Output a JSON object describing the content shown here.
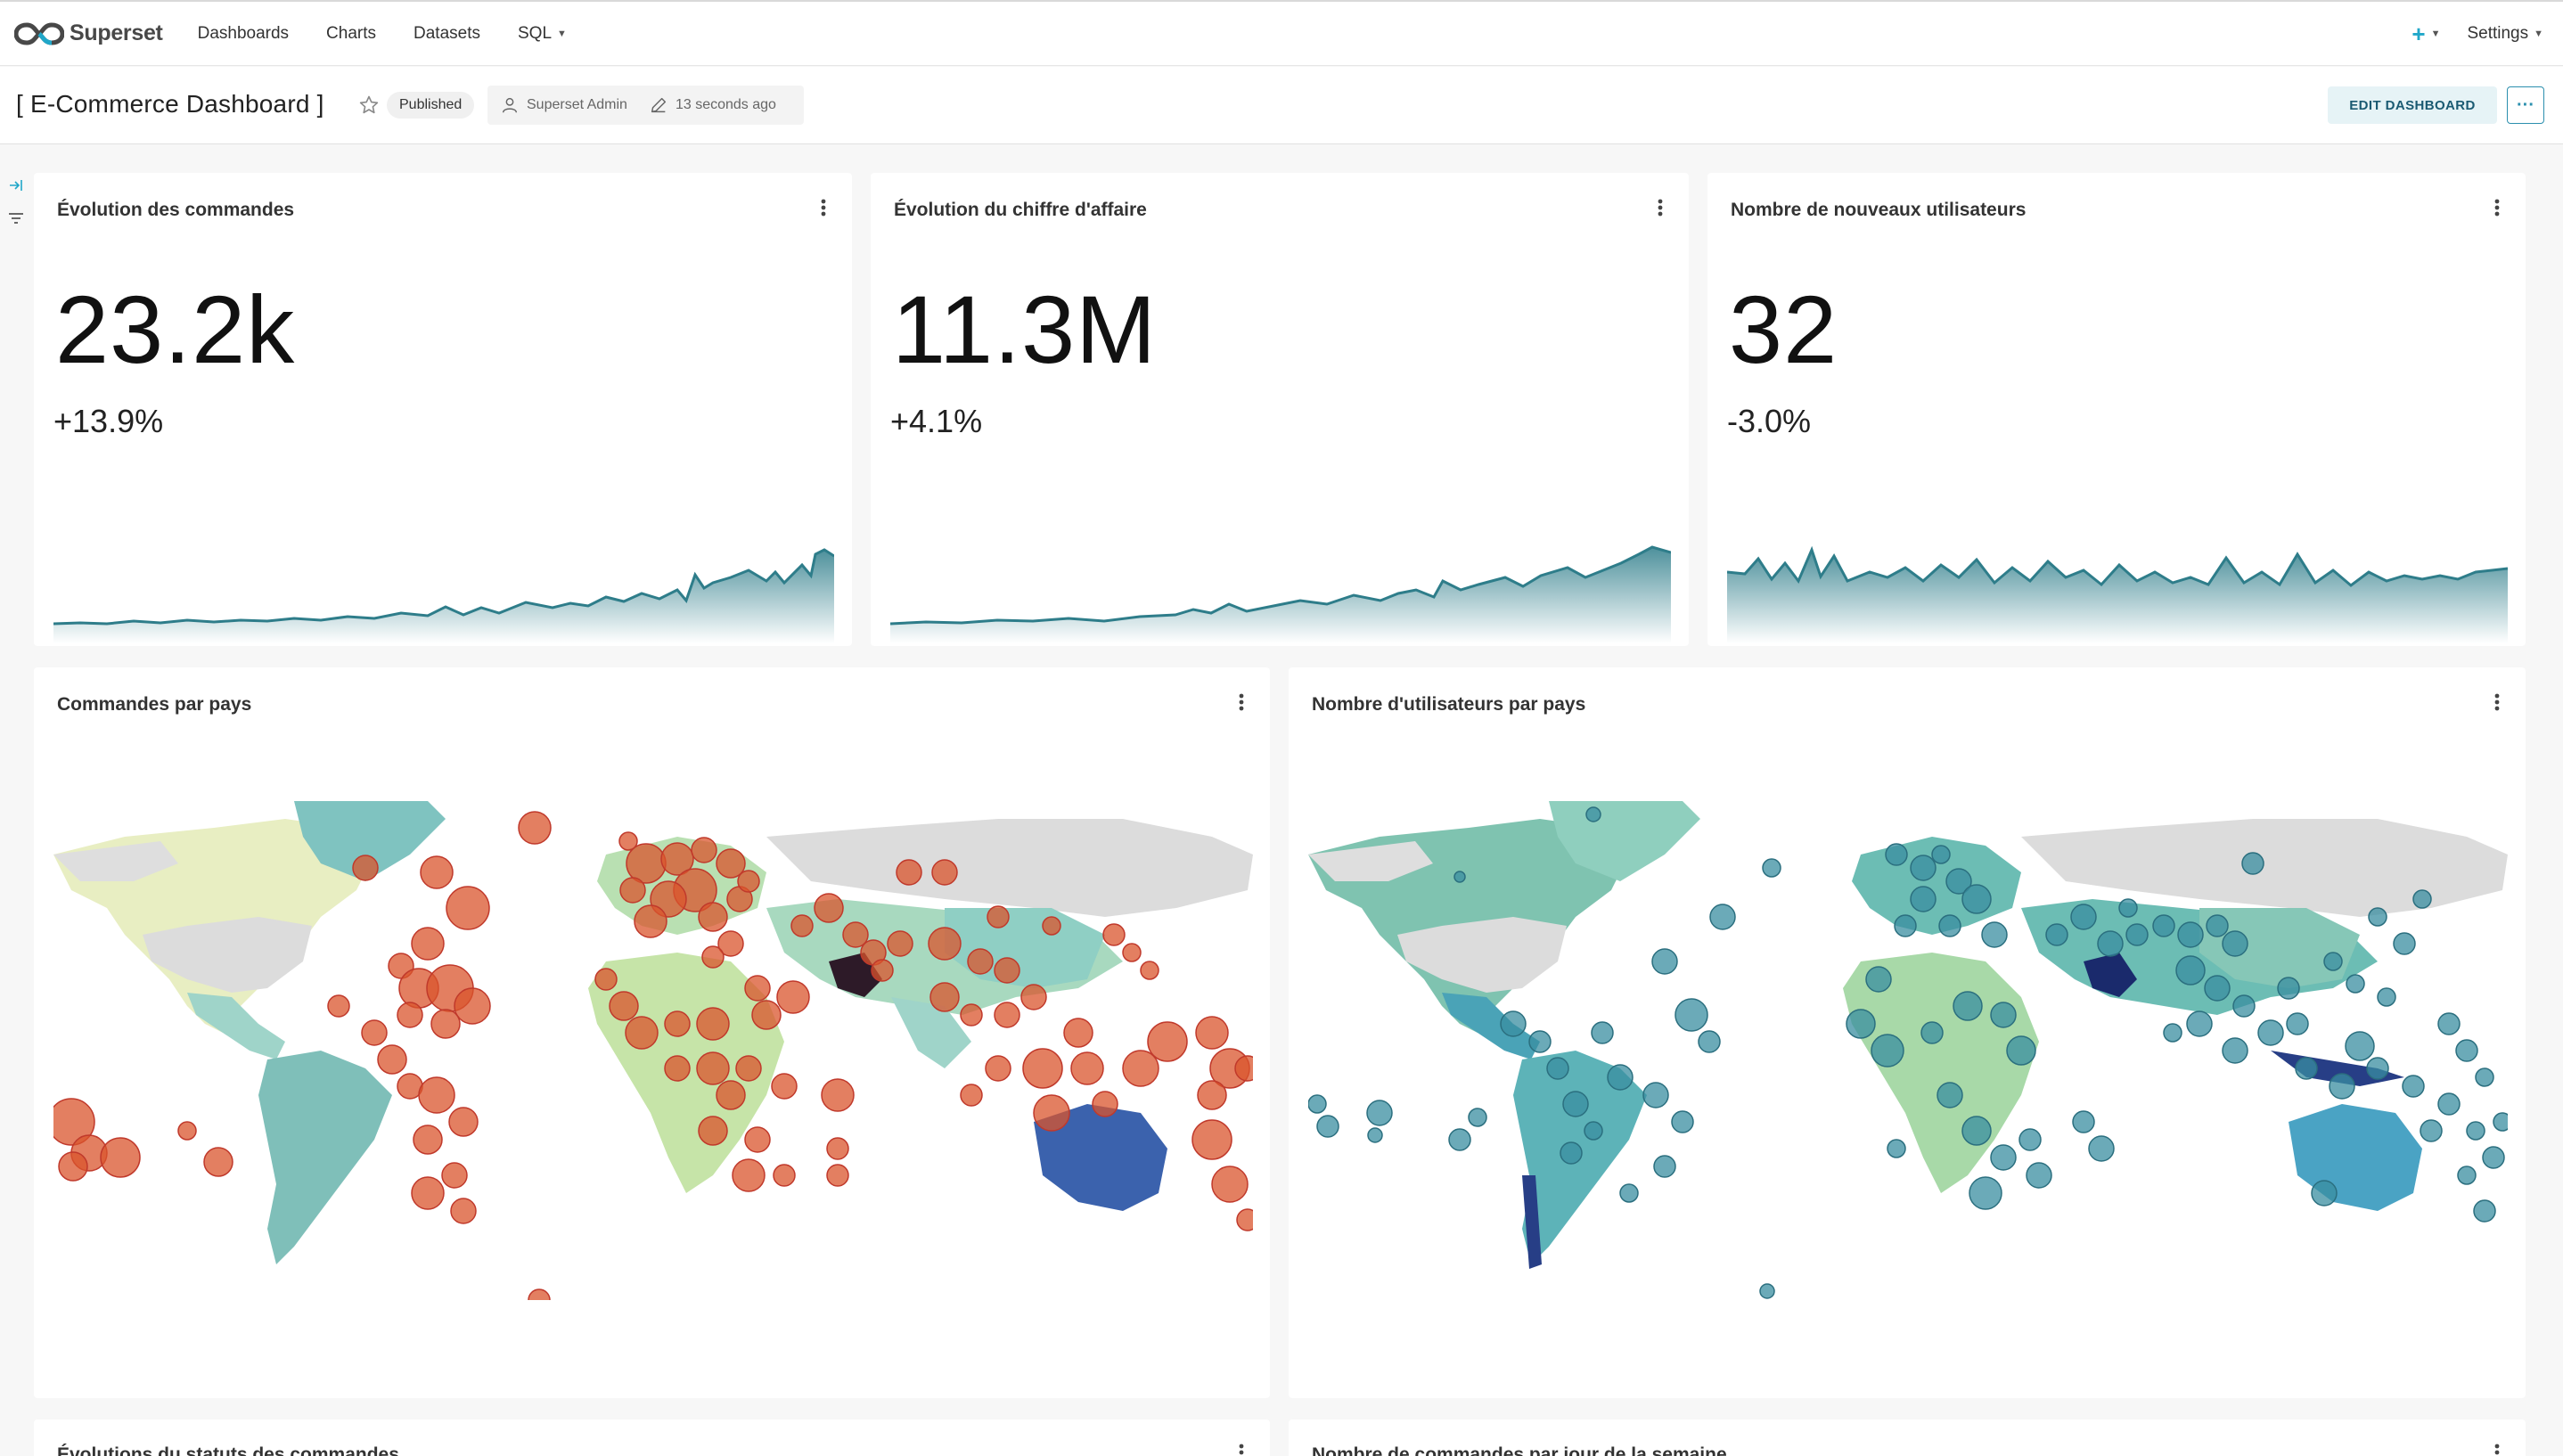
{
  "app": {
    "brand": "Superset"
  },
  "nav": {
    "items": [
      {
        "label": "Dashboards"
      },
      {
        "label": "Charts"
      },
      {
        "label": "Datasets"
      },
      {
        "label": "SQL"
      }
    ],
    "plus_icon": "plus-icon",
    "settings_label": "Settings"
  },
  "dashboard": {
    "title": "[ E-Commerce Dashboard ]",
    "status": "Published",
    "owner": "Superset Admin",
    "modified": "13 seconds ago",
    "edit_label": "EDIT DASHBOARD",
    "more_label": "···"
  },
  "colors": {
    "accent": "#20a7c9",
    "spark": "#2e7d8a",
    "bubble_orange": "#d9542c",
    "bubble_teal": "#3a8ea0"
  },
  "cards": {
    "orders": {
      "title": "Évolution des commandes",
      "value": "23.2k",
      "delta": "+13.9%"
    },
    "revenue": {
      "title": "Évolution du chiffre d'affaire",
      "value": "11.3M",
      "delta": "+4.1%"
    },
    "users": {
      "title": "Nombre de nouveaux utilisateurs",
      "value": "32",
      "delta": "-3.0%"
    },
    "orders_map": {
      "title": "Commandes par pays"
    },
    "users_map": {
      "title": "Nombre d'utilisateurs par pays"
    },
    "status_chart": {
      "title": "Évolutions du statuts des commandes"
    },
    "weekday_chart": {
      "title": "Nombre de commandes par jour de la semaine"
    }
  }
}
